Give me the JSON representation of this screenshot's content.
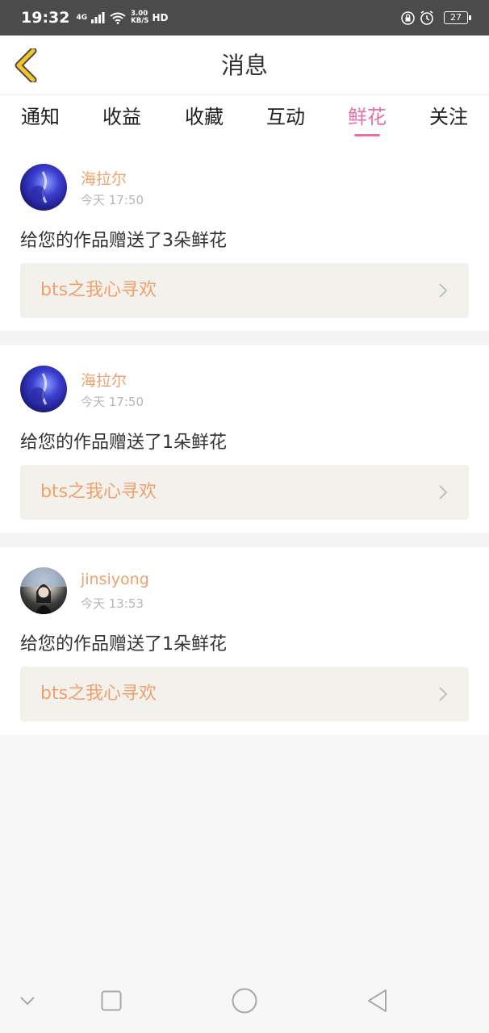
{
  "status_bar": {
    "time": "19:32",
    "network": "4G",
    "speed_value": "3.00",
    "speed_unit": "KB/S",
    "hd": "HD",
    "battery": "27"
  },
  "header": {
    "title": "消息",
    "back_icon": "chevron-left-icon"
  },
  "tabs": [
    {
      "label": "通知",
      "active": false
    },
    {
      "label": "收益",
      "active": false
    },
    {
      "label": "收藏",
      "active": false
    },
    {
      "label": "互动",
      "active": false
    },
    {
      "label": "鲜花",
      "active": true
    },
    {
      "label": "关注",
      "active": false
    }
  ],
  "notifications": [
    {
      "username": "海拉尔",
      "time": "今天 17:50",
      "message": "给您的作品赠送了3朵鲜花",
      "work_title": "bts之我心寻欢"
    },
    {
      "username": "海拉尔",
      "time": "今天 17:50",
      "message": "给您的作品赠送了1朵鲜花",
      "work_title": "bts之我心寻欢"
    },
    {
      "username": "jinsiyong",
      "time": "今天 13:53",
      "message": "给您的作品赠送了1朵鲜花",
      "work_title": "bts之我心寻欢"
    }
  ],
  "colors": {
    "accent": "#e96fa6",
    "username": "#f0a06d",
    "back_icon": "#f4c52a",
    "status_bar": "#4b4b4b"
  },
  "nav_icons": [
    "chevron-down-icon",
    "square-icon",
    "circle-icon",
    "triangle-back-icon"
  ]
}
